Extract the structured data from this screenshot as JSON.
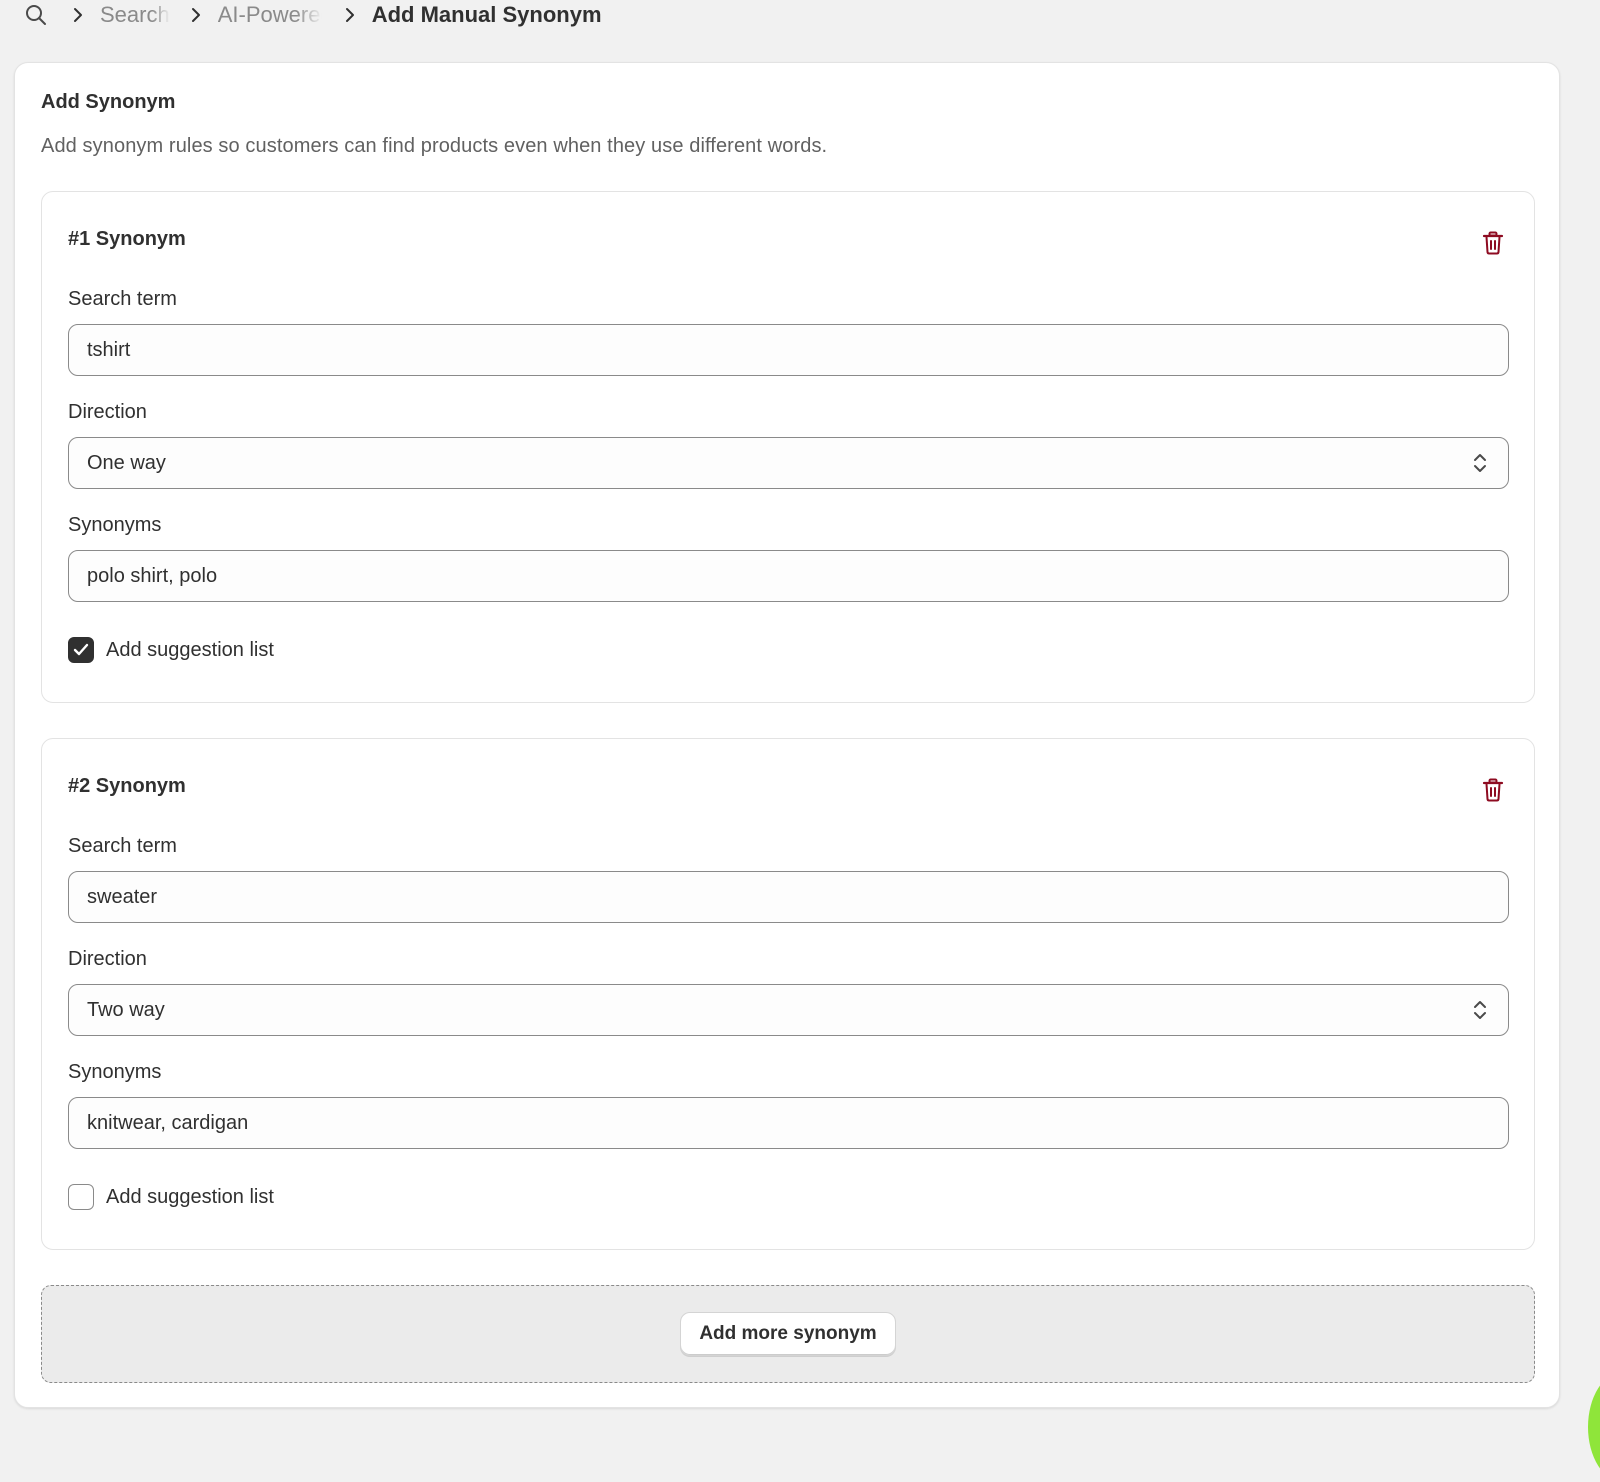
{
  "breadcrumb": {
    "icon": "search-icon",
    "items": [
      "Search",
      "AI-Powered"
    ],
    "current": "Add Manual Synonym"
  },
  "card": {
    "title": "Add Synonym",
    "description": "Add synonym rules so customers can find products even when they use different words."
  },
  "labels": {
    "search_term": "Search term",
    "direction": "Direction",
    "synonyms": "Synonyms",
    "suggestion": "Add suggestion list"
  },
  "rules": [
    {
      "title": "#1 Synonym",
      "search_term": "tshirt",
      "direction": "One way",
      "synonyms": "polo shirt, polo",
      "suggestion_checked": true
    },
    {
      "title": "#2 Synonym",
      "search_term": "sweater",
      "direction": "Two way",
      "synonyms": "knitwear, cardigan",
      "suggestion_checked": false
    }
  ],
  "add_more_label": "Add more synonym",
  "colors": {
    "accent_dark": "#303030",
    "delete_red": "#8e0b21",
    "page_bg": "#f1f1f1"
  }
}
